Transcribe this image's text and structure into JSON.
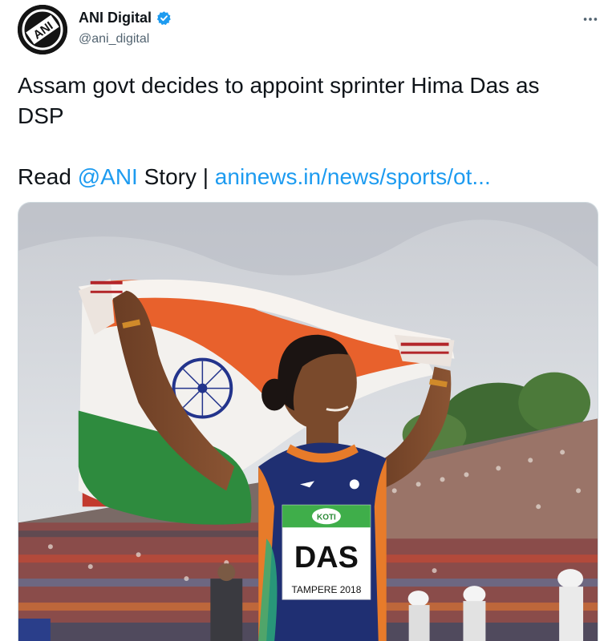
{
  "author": {
    "name": "ANI Digital",
    "handle": "@ani_digital",
    "avatar_text": "ANI",
    "verified": true
  },
  "tweet": {
    "line1": "Assam govt decides to appoint sprinter Hima Das as DSP",
    "read_prefix": "Read ",
    "mention": "@ANI",
    "story_sep": " Story | ",
    "url": "aninews.in/news/sports/ot..."
  },
  "media": {
    "bib_top": "KOTI",
    "bib_name": "DAS",
    "bib_event": "TAMPERE 2018"
  },
  "icons": {
    "more": "more-horizontal-icon",
    "verified": "verified-badge-icon"
  },
  "colors": {
    "link": "#1d9bf0",
    "verified": "#1d9bf0"
  }
}
